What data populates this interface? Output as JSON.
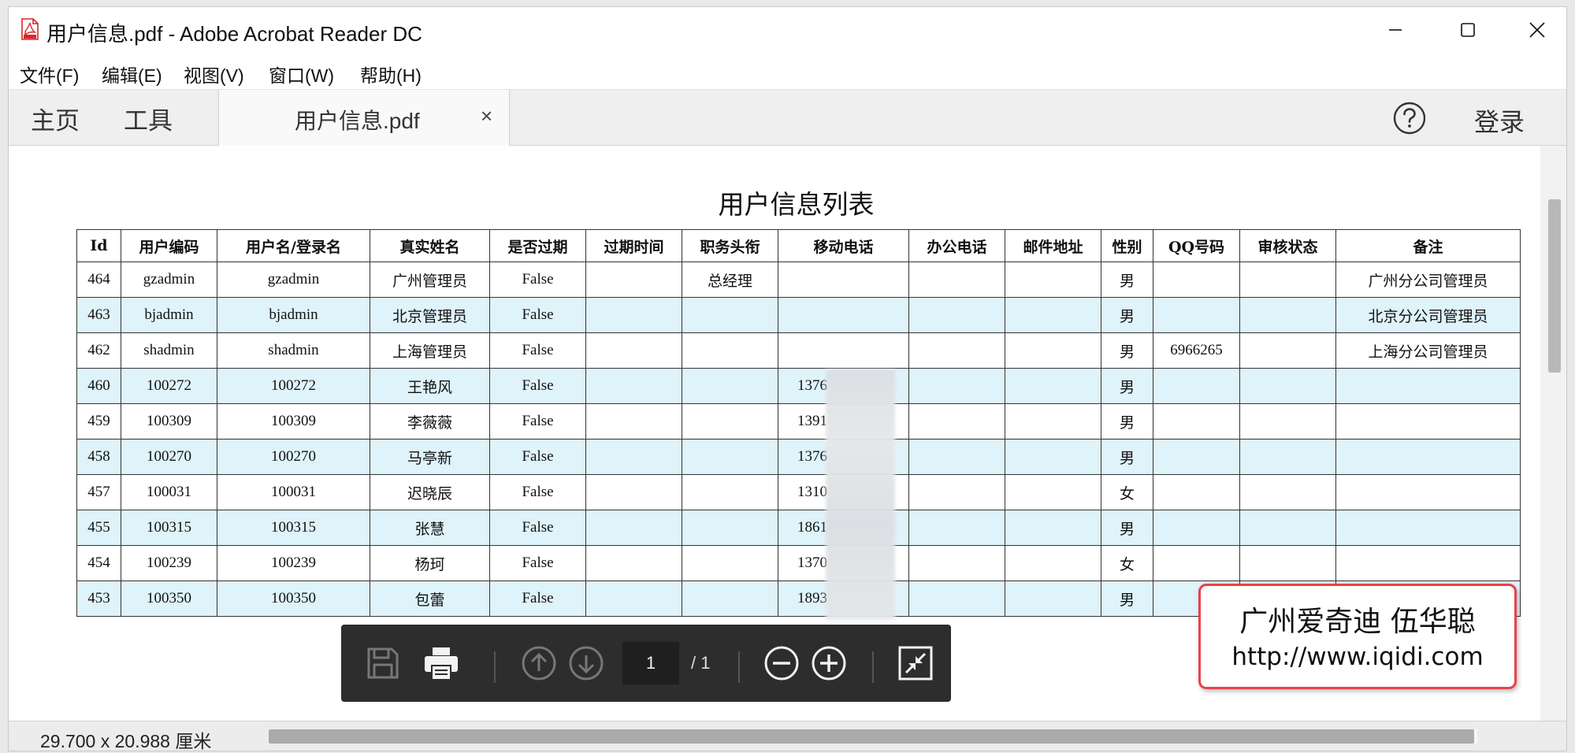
{
  "window": {
    "title": "用户信息.pdf - Adobe Acrobat Reader DC"
  },
  "menu": [
    "文件(F)",
    "编辑(E)",
    "视图(V)",
    "窗口(W)",
    "帮助(H)"
  ],
  "nav": {
    "home": "主页",
    "tools": "工具",
    "tab_label": "用户信息.pdf",
    "tab_close": "×",
    "login": "登录"
  },
  "document": {
    "title": "用户信息列表",
    "columns": [
      "Id",
      "用户编码",
      "用户名/登录名",
      "真实姓名",
      "是否过期",
      "过期时间",
      "职务头衔",
      "移动电话",
      "办公电话",
      "邮件地址",
      "性别",
      "QQ号码",
      "审核状态",
      "备注"
    ],
    "rows": [
      [
        "464",
        "gzadmin",
        "gzadmin",
        "广州管理员",
        "False",
        "",
        "总经理",
        "",
        "",
        "",
        "男",
        "",
        "",
        "广州分公司管理员"
      ],
      [
        "463",
        "bjadmin",
        "bjadmin",
        "北京管理员",
        "False",
        "",
        "",
        "",
        "",
        "",
        "男",
        "",
        "",
        "北京分公司管理员"
      ],
      [
        "462",
        "shadmin",
        "shadmin",
        "上海管理员",
        "False",
        "",
        "",
        "",
        "",
        "",
        "男",
        "6966265",
        "",
        "上海分公司管理员"
      ],
      [
        "460",
        "100272",
        "100272",
        "王艳风",
        "False",
        "",
        "",
        "1376",
        "",
        "",
        "男",
        "",
        "",
        ""
      ],
      [
        "459",
        "100309",
        "100309",
        "李薇薇",
        "False",
        "",
        "",
        "1391",
        "",
        "",
        "男",
        "",
        "",
        ""
      ],
      [
        "458",
        "100270",
        "100270",
        "马亭新",
        "False",
        "",
        "",
        "1376",
        "",
        "",
        "男",
        "",
        "",
        ""
      ],
      [
        "457",
        "100031",
        "100031",
        "迟晓辰",
        "False",
        "",
        "",
        "1310",
        "",
        "",
        "女",
        "",
        "",
        ""
      ],
      [
        "455",
        "100315",
        "100315",
        "张慧",
        "False",
        "",
        "",
        "1861",
        "",
        "",
        "男",
        "",
        "",
        ""
      ],
      [
        "454",
        "100239",
        "100239",
        "杨珂",
        "False",
        "",
        "",
        "1370",
        "",
        "",
        "女",
        "",
        "",
        ""
      ],
      [
        "453",
        "100350",
        "100350",
        "包蕾",
        "False",
        "",
        "",
        "1893",
        "",
        "",
        "男",
        "",
        "",
        ""
      ]
    ]
  },
  "toolbar": {
    "current_page": "1",
    "total_pages": "/ 1"
  },
  "watermark": {
    "line1": "广州爱奇迪 伍华聪",
    "line2": "http://www.iqidi.com"
  },
  "status": {
    "page_size": "29.700 x 20.988 厘米"
  },
  "colors": {
    "row_alt": "#dff3fb",
    "toolbar_bg": "#2d2d2d",
    "watermark_border": "#e8414a",
    "pdf_icon": "#d9262b"
  }
}
